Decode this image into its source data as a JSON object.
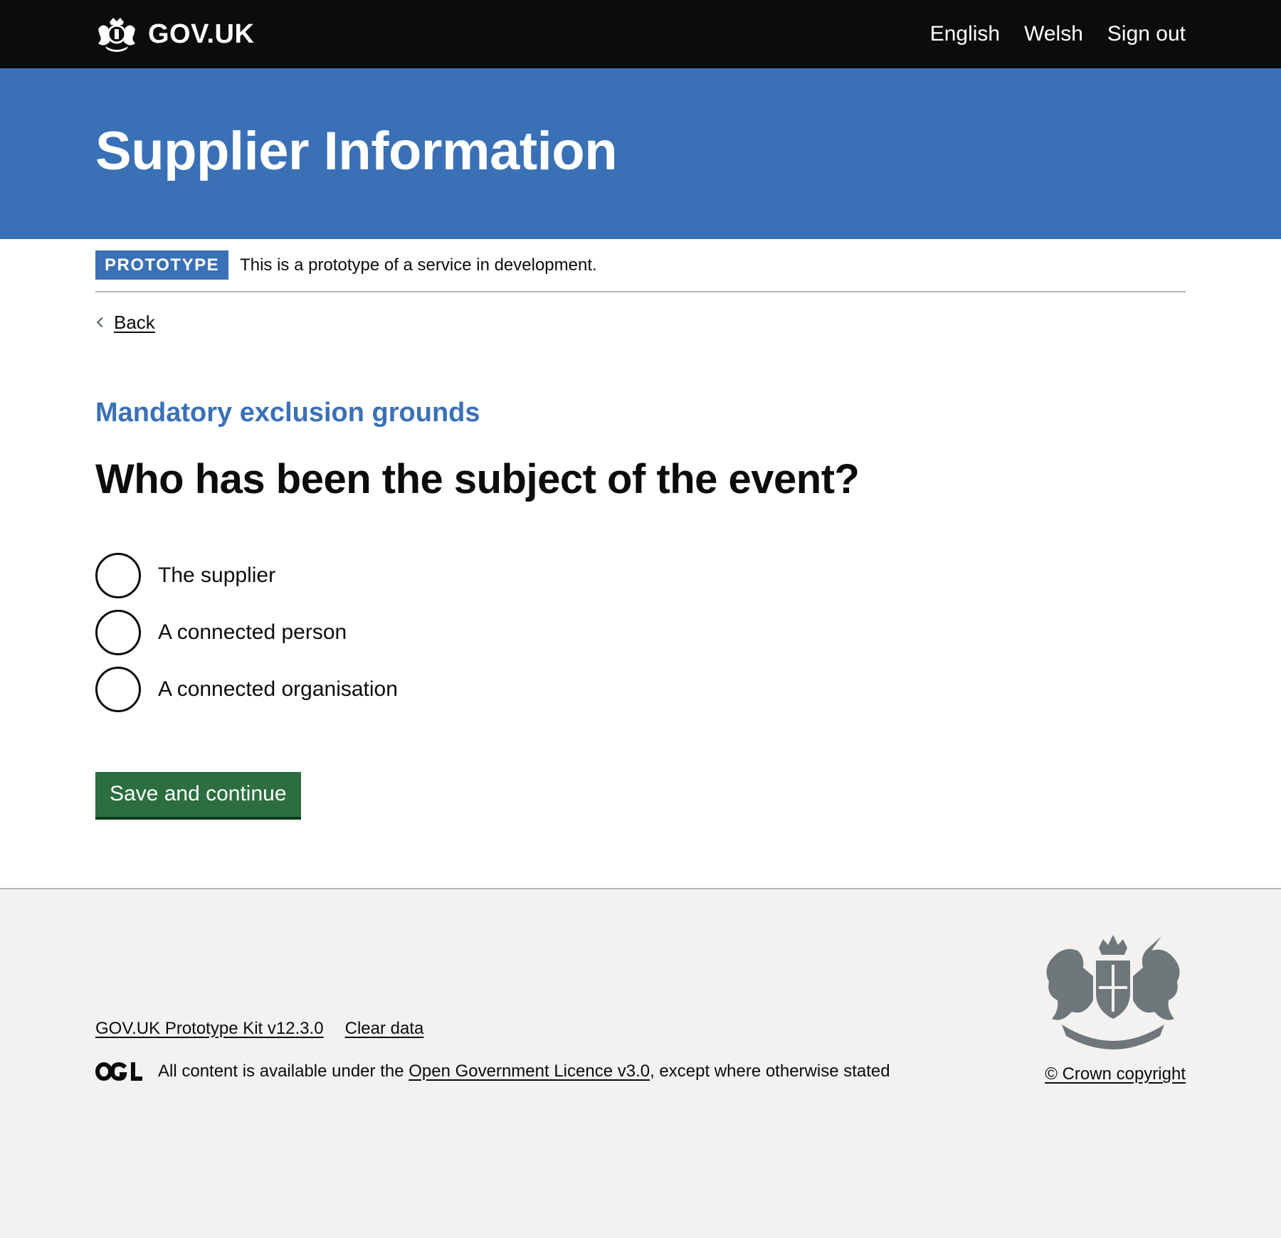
{
  "header": {
    "logo_text": "GOV.UK",
    "links": [
      "English",
      "Welsh",
      "Sign out"
    ]
  },
  "banner": {
    "service_name": "Supplier Information"
  },
  "phase": {
    "tag": "PROTOTYPE",
    "text": "This is a prototype of a service in development."
  },
  "back_link": "Back",
  "form": {
    "caption": "Mandatory exclusion grounds",
    "question": "Who has been the subject of the event?",
    "options": [
      "The supplier",
      "A connected person",
      "A connected organisation"
    ],
    "submit_label": "Save and continue"
  },
  "footer": {
    "links": [
      "GOV.UK Prototype Kit v12.3.0",
      "Clear data"
    ],
    "licence_prefix": "All content is available under the ",
    "licence_link": "Open Government Licence v3.0",
    "licence_suffix": ", except where otherwise stated",
    "copyright": "© Crown copyright"
  },
  "colors": {
    "header_bg": "#0b0c0c",
    "brand_blue": "#3a70b6",
    "button_green": "#2c6e3f",
    "footer_bg": "#f3f2f1"
  }
}
